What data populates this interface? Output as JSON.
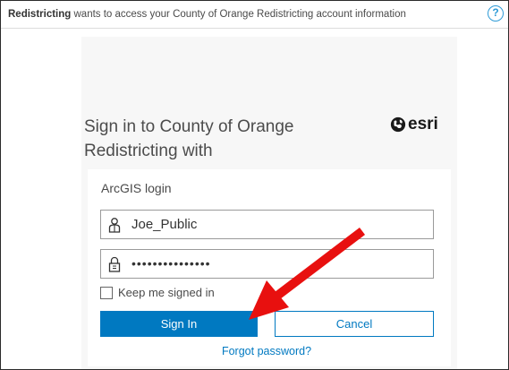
{
  "consent": {
    "app_name": "Redistricting",
    "message": " wants to access your County of Orange Redistricting account information",
    "help_symbol": "?"
  },
  "signin": {
    "heading": "Sign in to County of Orange Redistricting with",
    "brand": "esri"
  },
  "login": {
    "title": "ArcGIS login",
    "username_value": "Joe_Public",
    "password_mask": "•••••••••••••••",
    "keep_signed_in_label": "Keep me signed in",
    "keep_signed_in_checked": false,
    "sign_in_label": "Sign In",
    "cancel_label": "Cancel",
    "forgot_label": "Forgot password?"
  },
  "colors": {
    "accent": "#0079c1",
    "annotation_arrow": "#e8100f"
  },
  "icons": {
    "help": "help-icon",
    "brand": "globe-icon",
    "username": "user-icon",
    "password": "lock-icon"
  }
}
